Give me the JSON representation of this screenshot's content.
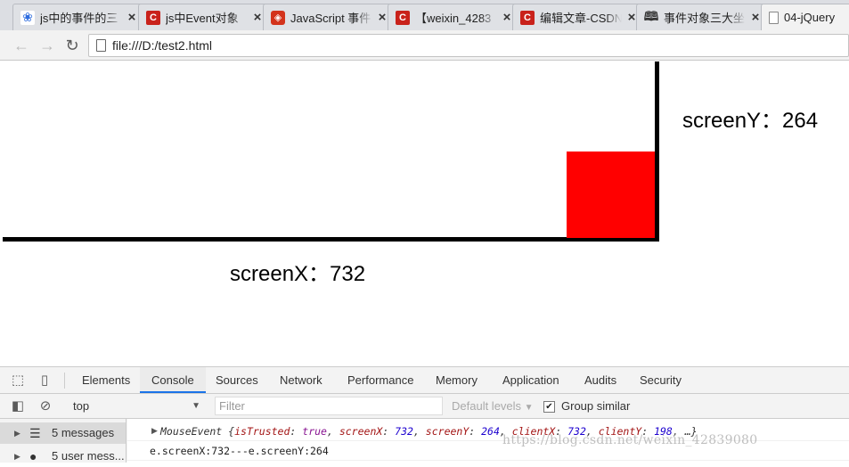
{
  "browser": {
    "tabs": [
      {
        "title": "js中的事件的三",
        "favicon": "baidu-paw-icon",
        "active": false
      },
      {
        "title": "js中Event对象",
        "favicon": "csdn-icon",
        "active": false
      },
      {
        "title": "JavaScript 事件",
        "favicon": "runoob-icon",
        "active": false
      },
      {
        "title": "【weixin_4283",
        "favicon": "csdn-icon",
        "active": false
      },
      {
        "title": "编辑文章-CSDN",
        "favicon": "csdn-icon",
        "active": false
      },
      {
        "title": "事件对象三大坐",
        "favicon": "open-book-icon",
        "active": false
      },
      {
        "title": "04-jQuery",
        "favicon": "page-icon",
        "active": true
      }
    ],
    "close_glyph": "×",
    "address": "file:///D:/test2.html"
  },
  "page": {
    "screen_y_label": "screenY：264",
    "screen_x_label": "screenX：732",
    "box_color": "#ff0000"
  },
  "devtools": {
    "tabs": [
      "Elements",
      "Console",
      "Sources",
      "Network",
      "Performance",
      "Memory",
      "Application",
      "Audits",
      "Security"
    ],
    "active_tab": "Console",
    "context": "top",
    "filter_placeholder": "Filter",
    "levels_label": "Default levels",
    "group_similar_label": "Group similar",
    "group_similar_checked": true,
    "sidebar": [
      {
        "label": "5 messages",
        "selected": true
      },
      {
        "label": "5 user mess...",
        "selected": false
      }
    ],
    "log": {
      "object_prefix": "MouseEvent {",
      "k1": "isTrusted",
      "v1": "true",
      "k2": "screenX",
      "v2": "732",
      "k3": "screenY",
      "v3": "264",
      "k4": "clientX",
      "v4": "732",
      "k5": "clientY",
      "v5": "198",
      "suffix": "…}",
      "line2": "e.screenX:732---e.screenY:264"
    }
  },
  "watermark": "https://blog.csdn.net/weixin_42839080"
}
